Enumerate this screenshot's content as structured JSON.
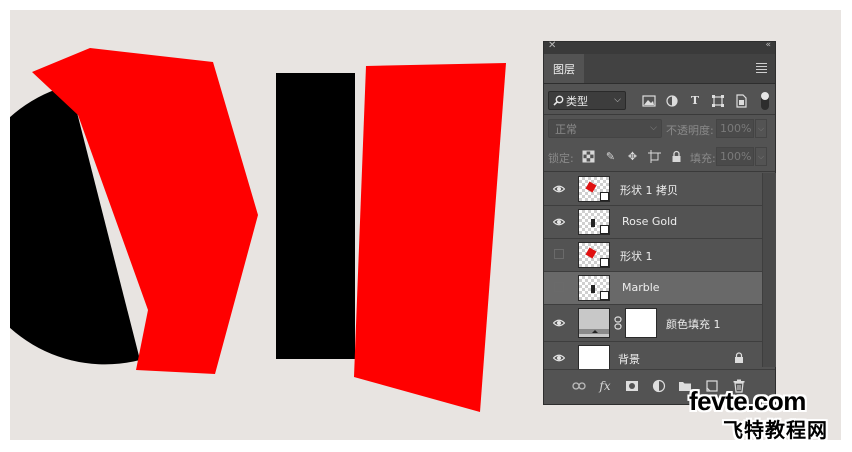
{
  "colors": {
    "canvas_bg": "#e8e4e1",
    "red": "#ff0000",
    "black": "#000000",
    "panel_bg": "#535353",
    "selected_row": "#696969"
  },
  "panel": {
    "tab_label": "图层",
    "filter": {
      "label": "类型",
      "icon": "search-icon"
    },
    "blend_mode": "正常",
    "opacity_label": "不透明度:",
    "opacity_value": "100%",
    "lock_label": "锁定:",
    "fill_label": "填充:",
    "fill_value": "100%",
    "layers": [
      {
        "name": "形状 1 拷贝",
        "visible": true,
        "selected": false,
        "thumb": "red-shape"
      },
      {
        "name": "Rose Gold",
        "visible": true,
        "selected": false,
        "thumb": "dark-shape"
      },
      {
        "name": "形状 1",
        "visible": false,
        "selected": false,
        "thumb": "red-shape"
      },
      {
        "name": "Marble",
        "visible": false,
        "selected": true,
        "thumb": "dark-shape"
      },
      {
        "name": "颜色填充 1",
        "visible": true,
        "selected": false,
        "thumb": "fill"
      },
      {
        "name": "背景",
        "visible": true,
        "selected": false,
        "thumb": "background",
        "locked": true
      }
    ],
    "bottom_icons": [
      "link-icon",
      "fx-icon",
      "mask-icon",
      "adjustment-icon",
      "folder-icon",
      "new-layer-icon",
      "trash-icon"
    ],
    "fx_label": "fx"
  },
  "watermark": {
    "line1": "fevte.com",
    "line2": "飞特教程网"
  }
}
